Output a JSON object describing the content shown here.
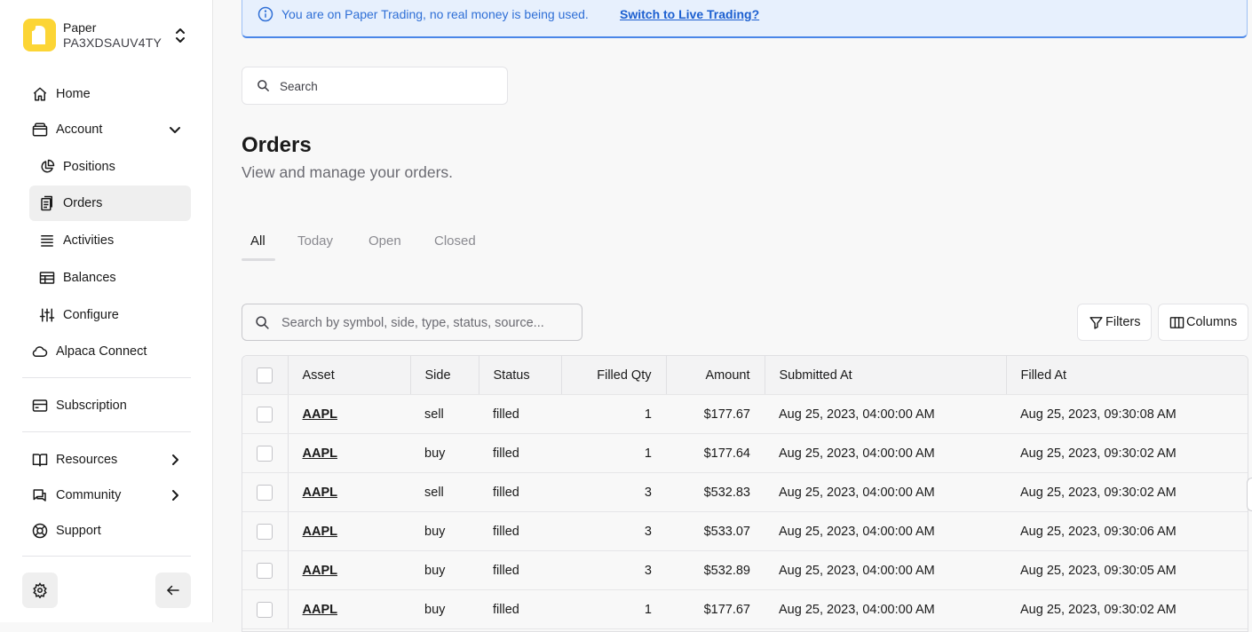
{
  "account": {
    "name": "Paper",
    "id": "PA3XDSAUV4TY"
  },
  "sidebar": {
    "items": [
      {
        "label": "Home",
        "icon": "home-icon"
      },
      {
        "label": "Account",
        "icon": "wallet-icon"
      },
      {
        "label": "Positions",
        "icon": "pie-chart-icon"
      },
      {
        "label": "Orders",
        "icon": "clipboard-icon"
      },
      {
        "label": "Activities",
        "icon": "list-icon"
      },
      {
        "label": "Balances",
        "icon": "table-icon"
      },
      {
        "label": "Configure",
        "icon": "sliders-icon"
      },
      {
        "label": "Alpaca Connect",
        "icon": "cloud-icon"
      },
      {
        "label": "Subscription",
        "icon": "credit-card-icon"
      },
      {
        "label": "Resources",
        "icon": "book-icon"
      },
      {
        "label": "Community",
        "icon": "chat-icon"
      },
      {
        "label": "Support",
        "icon": "lifebuoy-icon"
      }
    ]
  },
  "banner": {
    "message": "You are on Paper Trading, no real money is being used.",
    "link": "Switch to Live Trading?"
  },
  "search": {
    "placeholder": "Search"
  },
  "page": {
    "title": "Orders",
    "subtitle": "View and manage your orders."
  },
  "tabs": [
    "All",
    "Today",
    "Open",
    "Closed"
  ],
  "toolbar": {
    "search_placeholder": "Search by symbol, side, type, status, source...",
    "filters_label": "Filters",
    "columns_label": "Columns"
  },
  "table": {
    "headers": [
      "Asset",
      "Side",
      "Status",
      "Filled Qty",
      "Amount",
      "Submitted At",
      "Filled At"
    ],
    "rows": [
      {
        "asset": "AAPL",
        "side": "sell",
        "status": "filled",
        "qty": "1",
        "amount": "$177.67",
        "submitted": "Aug 25, 2023, 04:00:00 AM",
        "filled": "Aug 25, 2023, 09:30:08 AM"
      },
      {
        "asset": "AAPL",
        "side": "buy",
        "status": "filled",
        "qty": "1",
        "amount": "$177.64",
        "submitted": "Aug 25, 2023, 04:00:00 AM",
        "filled": "Aug 25, 2023, 09:30:02 AM"
      },
      {
        "asset": "AAPL",
        "side": "sell",
        "status": "filled",
        "qty": "3",
        "amount": "$532.83",
        "submitted": "Aug 25, 2023, 04:00:00 AM",
        "filled": "Aug 25, 2023, 09:30:02 AM"
      },
      {
        "asset": "AAPL",
        "side": "buy",
        "status": "filled",
        "qty": "3",
        "amount": "$533.07",
        "submitted": "Aug 25, 2023, 04:00:00 AM",
        "filled": "Aug 25, 2023, 09:30:06 AM"
      },
      {
        "asset": "AAPL",
        "side": "buy",
        "status": "filled",
        "qty": "3",
        "amount": "$532.89",
        "submitted": "Aug 25, 2023, 04:00:00 AM",
        "filled": "Aug 25, 2023, 09:30:05 AM"
      },
      {
        "asset": "AAPL",
        "side": "buy",
        "status": "filled",
        "qty": "1",
        "amount": "$177.67",
        "submitted": "Aug 25, 2023, 04:00:00 AM",
        "filled": "Aug 25, 2023, 09:30:02 AM"
      }
    ]
  },
  "colors": {
    "brand": "#fcd535",
    "banner_bg": "#e7f0fd",
    "banner_text": "#2f6fd6",
    "active_nav_bg": "#efefef"
  }
}
